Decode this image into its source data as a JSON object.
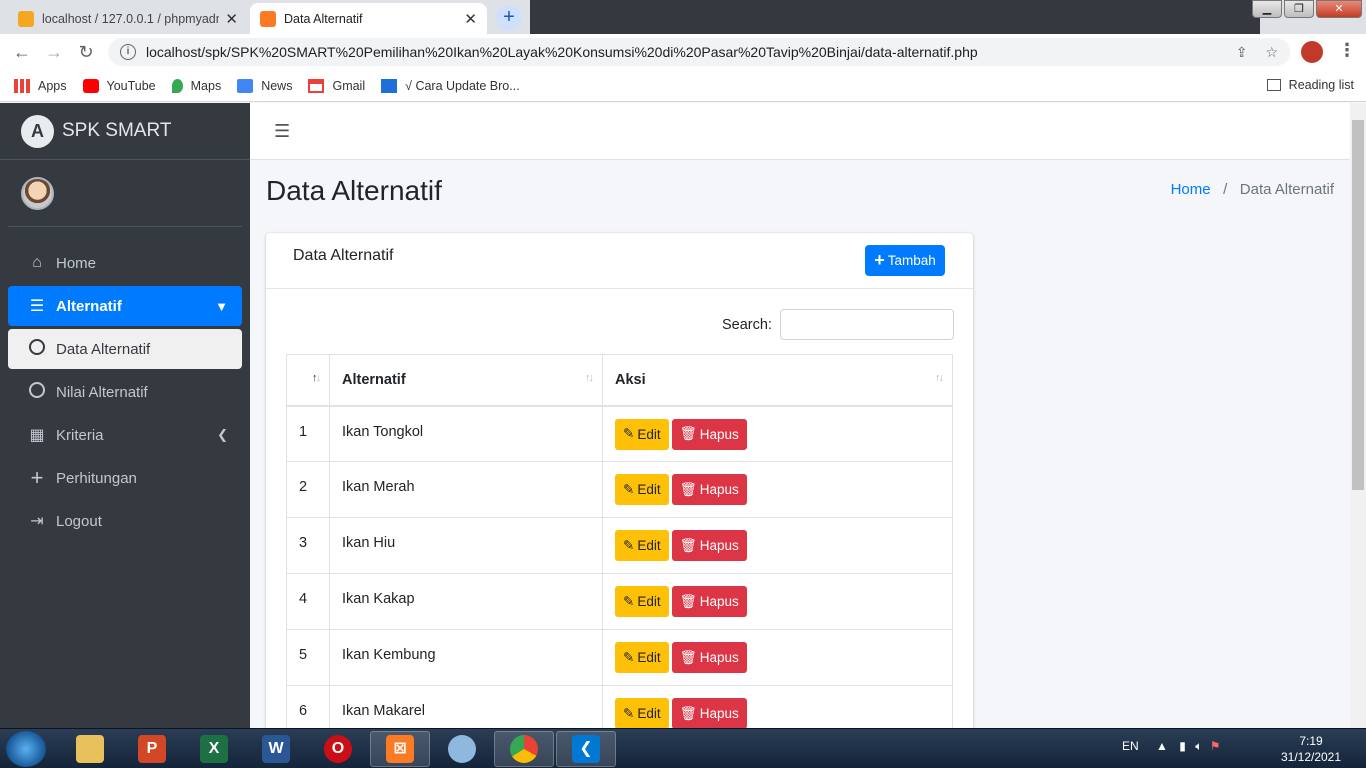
{
  "browser": {
    "tabs": [
      {
        "title": "localhost / 127.0.0.1 / phpmyadmin",
        "active": false
      },
      {
        "title": "Data Alternatif",
        "active": true
      }
    ],
    "url": "localhost/spk/SPK%20SMART%20Pemilihan%20Ikan%20Layak%20Konsumsi%20di%20Pasar%20Tavip%20Binjai/data-alternatif.php",
    "bookmarks": [
      "Apps",
      "YouTube",
      "Maps",
      "News",
      "Gmail",
      "√ Cara Update Bro..."
    ],
    "reading_list": "Reading list"
  },
  "sidebar": {
    "brand": "SPK SMART",
    "items": [
      {
        "label": "Home",
        "icon": "home-icon"
      },
      {
        "label": "Alternatif",
        "icon": "list-icon"
      },
      {
        "label": "Data Alternatif",
        "icon": "circle-icon"
      },
      {
        "label": "Nilai Alternatif",
        "icon": "circle-icon"
      },
      {
        "label": "Kriteria",
        "icon": "grid-icon"
      },
      {
        "label": "Perhitungan",
        "icon": "plus-icon"
      },
      {
        "label": "Logout",
        "icon": "logout-icon"
      }
    ]
  },
  "page": {
    "title": "Data Alternatif",
    "breadcrumb": {
      "home": "Home",
      "current": "Data Alternatif"
    }
  },
  "card": {
    "title": "Data Alternatif",
    "add_button": "Tambah",
    "search_label": "Search:",
    "columns": [
      "",
      "Alternatif",
      "Aksi"
    ],
    "rows": [
      {
        "no": "1",
        "name": "Ikan Tongkol"
      },
      {
        "no": "2",
        "name": "Ikan Merah"
      },
      {
        "no": "3",
        "name": "Ikan Hiu"
      },
      {
        "no": "4",
        "name": "Ikan Kakap"
      },
      {
        "no": "5",
        "name": "Ikan Kembung"
      },
      {
        "no": "6",
        "name": "Ikan Makarel"
      }
    ],
    "edit_label": "Edit",
    "delete_label": "Hapus"
  },
  "taskbar": {
    "lang": "EN",
    "time": "7:19",
    "date": "31/12/2021"
  },
  "colors": {
    "primary": "#007bff",
    "warning": "#ffc107",
    "danger": "#dc3545",
    "sidebar": "#343a40"
  }
}
